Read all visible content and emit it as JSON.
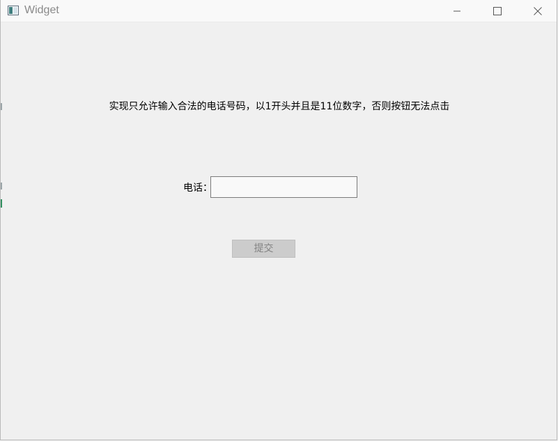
{
  "window": {
    "title": "Widget",
    "minimize_icon": "minimize-icon",
    "maximize_icon": "maximize-icon",
    "close_icon": "close-icon",
    "app_icon": "app-window-icon"
  },
  "main": {
    "instruction": "实现只允许输入合法的电话号码，以1开头并且是11位数字，否则按钮无法点击",
    "phone_label": "电话：",
    "phone_value": "",
    "submit_label": "提交",
    "submit_enabled": false
  },
  "colors": {
    "background": "#f0f0f0",
    "titlebar": "#f9f9f9",
    "disabled_button_bg": "#cccccc",
    "disabled_button_text": "#838383"
  }
}
